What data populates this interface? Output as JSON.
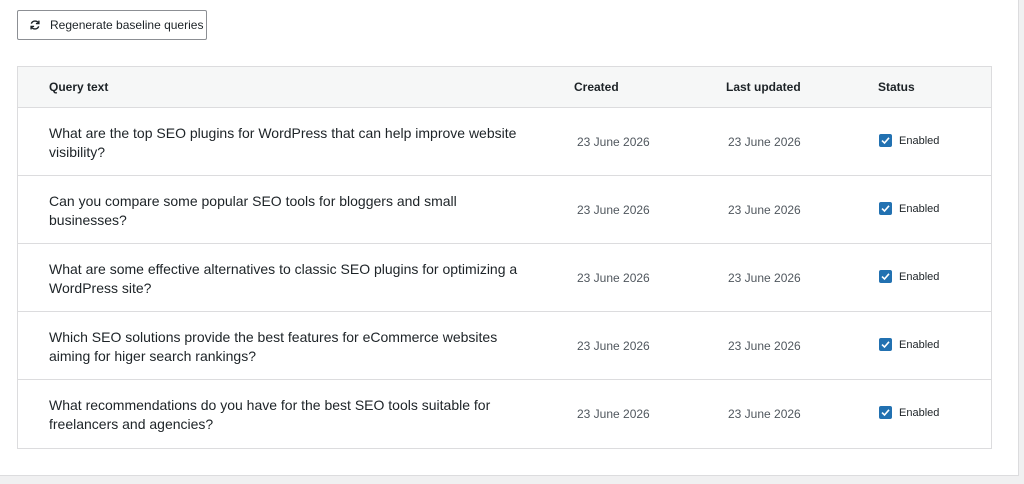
{
  "toolbar": {
    "regenerate_label": "Regenerate baseline queries",
    "regenerate_icon": "refresh-icon"
  },
  "table": {
    "headers": {
      "query": "Query text",
      "created": "Created",
      "updated": "Last updated",
      "status": "Status"
    },
    "rows": [
      {
        "query": "What are the top SEO plugins for WordPress that can help improve website visibility?",
        "created": "23 June 2026",
        "updated": "23 June 2026",
        "status": "Enabled",
        "checked": true
      },
      {
        "query": "Can you compare some popular SEO tools for bloggers and small businesses?",
        "created": "23 June 2026",
        "updated": "23 June 2026",
        "status": "Enabled",
        "checked": true
      },
      {
        "query": "What are some effective alternatives to classic SEO plugins for optimizing a WordPress site?",
        "created": "23 June 2026",
        "updated": "23 June 2026",
        "status": "Enabled",
        "checked": true
      },
      {
        "query": "Which SEO solutions provide the best features for eCommerce websites aiming for higer search rankings?",
        "created": "23 June 2026",
        "updated": "23 June 2026",
        "status": "Enabled",
        "checked": true
      },
      {
        "query": "What recommendations do you have for the best SEO tools suitable for freelancers and agencies?",
        "created": "23 June 2026",
        "updated": "23 June 2026",
        "status": "Enabled",
        "checked": true
      }
    ]
  },
  "colors": {
    "accent": "#2271b1",
    "border": "#dcdcde",
    "header_bg": "#f6f7f7"
  }
}
